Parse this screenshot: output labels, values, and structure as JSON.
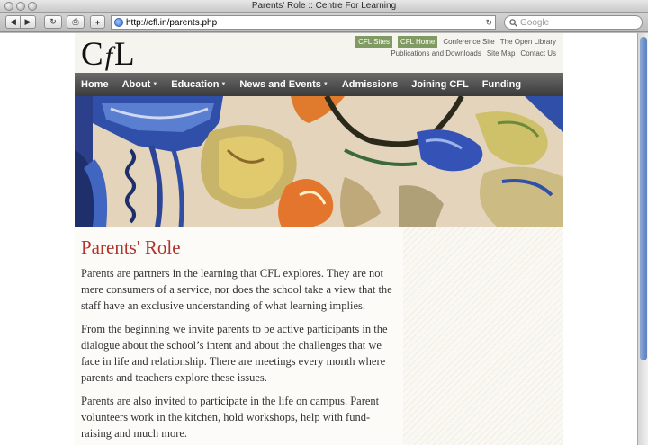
{
  "window": {
    "title": "Parents' Role :: Centre For Learning"
  },
  "toolbar": {
    "back_label": "◀",
    "forward_label": "▶",
    "reload_label": "↻",
    "bookmark_label": "⎙",
    "add_label": "+",
    "url": "http://cfl.in/parents.php",
    "search_placeholder": "Google"
  },
  "site": {
    "logo": {
      "c": "C",
      "f": "f",
      "l": "L"
    },
    "toplinks": {
      "row1": [
        "CFL Sites",
        "CFL Home",
        "Conference Site",
        "The Open Library"
      ],
      "row2": [
        "Publications and Downloads",
        "Site Map",
        "Contact Us"
      ]
    },
    "nav": [
      {
        "label": "Home",
        "caret": false
      },
      {
        "label": "About",
        "caret": true
      },
      {
        "label": "Education",
        "caret": true
      },
      {
        "label": "News and Events",
        "caret": true
      },
      {
        "label": "Admissions",
        "caret": false
      },
      {
        "label": "Joining CFL",
        "caret": false
      },
      {
        "label": "Funding",
        "caret": false
      }
    ],
    "accent_color": "#b0322b",
    "pill_color": "#7f9b62"
  },
  "content": {
    "title": "Parents' Role",
    "paragraphs": [
      "Parents are partners in the learning that CFL explores. They are not mere consumers of a service, nor does the school take a view that the staff have an exclusive understanding of what learning implies.",
      "From the beginning we invite parents to be active participants in the dialogue about the school’s intent and about the challenges that we face in life and relationship. There are meetings every month where parents and teachers explore these issues.",
      "Parents are also invited to participate in the life on campus. Parent volunteers work in the kitchen, hold workshops, help with fund-raising and much more."
    ]
  }
}
